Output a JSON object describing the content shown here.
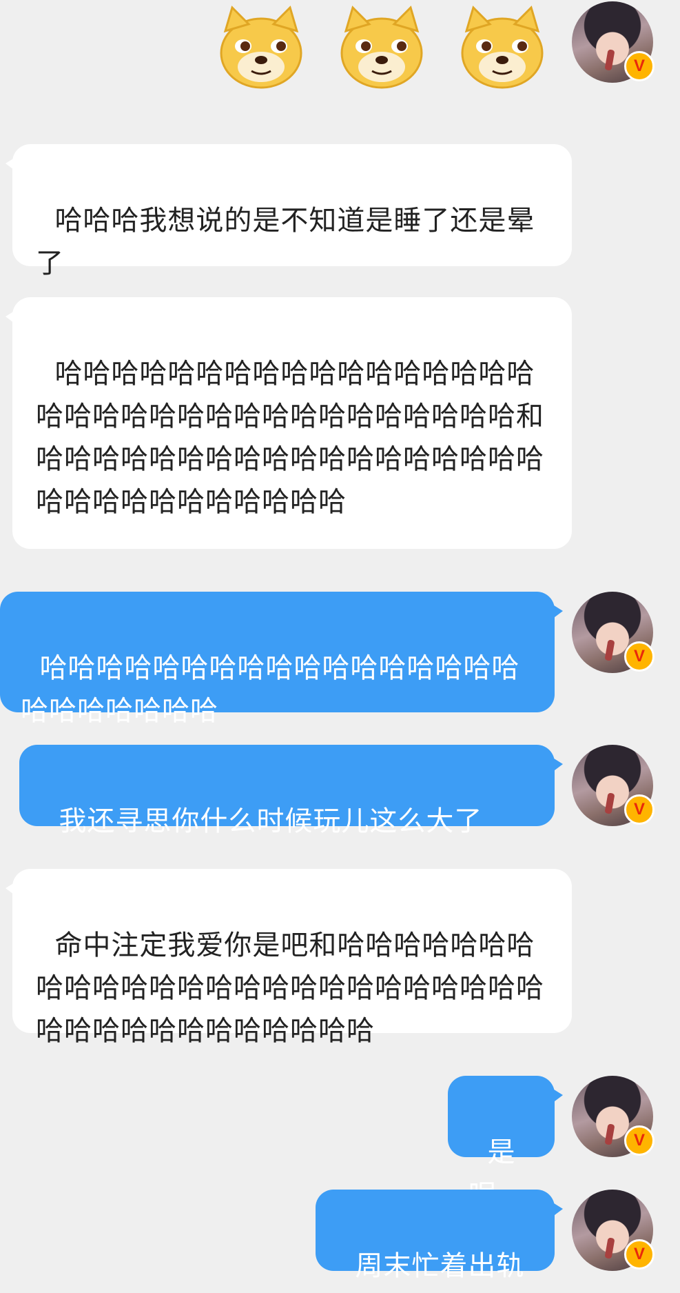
{
  "colors": {
    "background": "#efefef",
    "left_bubble": "#ffffff",
    "right_bubble": "#3d9df5",
    "badge": "#ffb400"
  },
  "stickers": [
    "doge-emoji",
    "doge-emoji",
    "doge-emoji"
  ],
  "verified_badge": "V",
  "messages": [
    {
      "side": "left",
      "text": "哈哈哈我想说的是不知道是睡了还是晕了"
    },
    {
      "side": "left",
      "text": "哈哈哈哈哈哈哈哈哈哈哈哈哈哈哈哈哈哈哈哈哈哈哈哈哈哈哈哈哈哈哈哈哈哈和哈哈哈哈哈哈哈哈哈哈哈哈哈哈哈哈哈哈哈哈哈哈哈哈哈哈哈哈哈"
    },
    {
      "side": "right",
      "text": "哈哈哈哈哈哈哈哈哈哈哈哈哈哈哈哈哈哈哈哈哈哈哈哈"
    },
    {
      "side": "right",
      "text": "我还寻思你什么时候玩儿这么大了"
    },
    {
      "side": "left",
      "text": "命中注定我爱你是吧和哈哈哈哈哈哈哈哈哈哈哈哈哈哈哈哈哈哈哈哈哈哈哈哈哈哈哈哈哈哈哈哈哈哈哈哈哈"
    },
    {
      "side": "right",
      "text": "是呢"
    },
    {
      "side": "right",
      "text": "周末忙着出轨"
    }
  ]
}
